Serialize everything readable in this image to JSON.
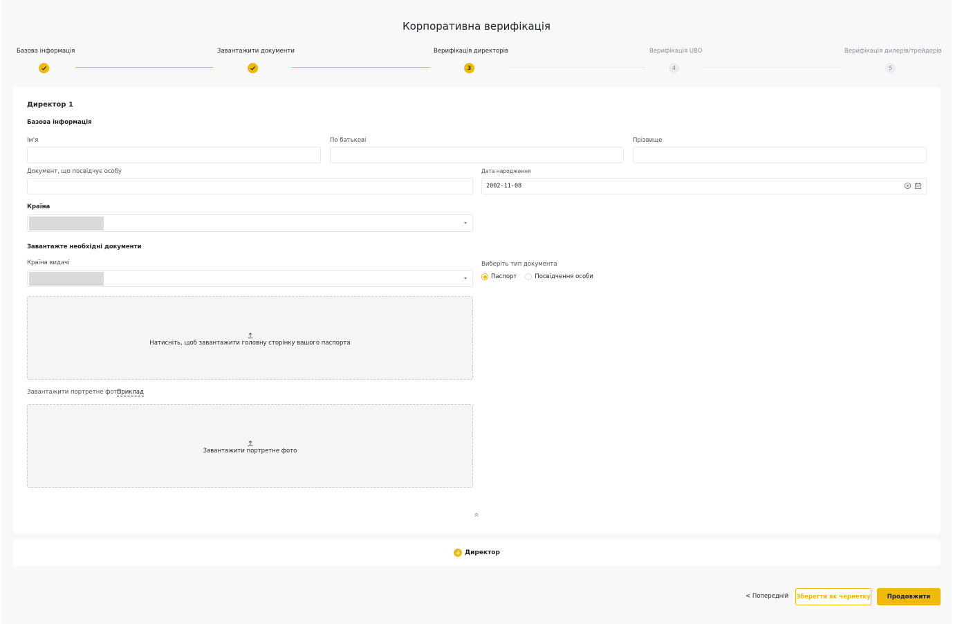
{
  "header": {
    "title": "Корпоративна верифікація"
  },
  "steps": [
    {
      "label": "Базова інформація",
      "status": "done",
      "number": "1"
    },
    {
      "label": "Завантажити документи",
      "status": "done",
      "number": "2"
    },
    {
      "label": "Верифікація директорів",
      "status": "active",
      "number": "3"
    },
    {
      "label": "Верифікація UBO",
      "status": "pending",
      "number": "4"
    },
    {
      "label": "Верифікація дилерів/трейдерів",
      "status": "pending",
      "number": "5"
    }
  ],
  "form": {
    "director_title": "Директор 1",
    "basic_info_title": "Базова інформація",
    "first_name": {
      "label": "Ім'я",
      "value": ""
    },
    "patronymic": {
      "label": "По батькові",
      "value": ""
    },
    "last_name": {
      "label": "Прізвище",
      "value": ""
    },
    "id_document": {
      "label": "Документ, що посвідчує особу",
      "value": ""
    },
    "birth_date": {
      "label": "Дата народження",
      "value": "2002-11-08"
    },
    "country": {
      "label": "Країна",
      "value": ""
    },
    "upload_section_title": "Завантажте необхідні документи",
    "issuing_country": {
      "label": "Країна видачі",
      "value": ""
    },
    "doc_type": {
      "label": "Виберіть тип документа",
      "options": [
        "Паспорт",
        "Посвідчення особи"
      ],
      "selected": "Паспорт"
    },
    "passport_upload_text": "Натисніть, щоб завантажити головну сторінку вашого паспорта",
    "portrait_label": "Завантажити портретне фото",
    "portrait_example_link": "Приклад",
    "portrait_upload_text": "Завантажити портретне фото"
  },
  "add_director": {
    "label": "Директор"
  },
  "footer": {
    "prev_label": "< Попередній",
    "draft_label": "Зберегти як чернетку",
    "continue_label": "Продовжити"
  },
  "colors": {
    "accent": "#f0b90b",
    "text": "#1e2329",
    "muted": "#848e9c"
  },
  "icons": [
    "check-icon",
    "calendar-icon",
    "clear-icon",
    "chevron-down-icon",
    "upload-icon",
    "collapse-up-icon",
    "plus-circle-icon"
  ]
}
